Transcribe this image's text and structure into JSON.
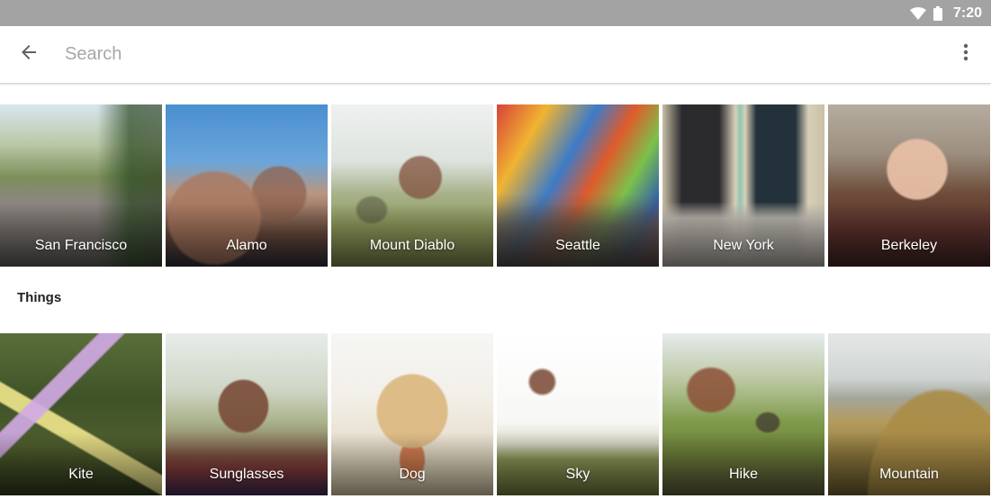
{
  "status_bar": {
    "time": "7:20",
    "icons": [
      "wifi-icon",
      "battery-icon"
    ]
  },
  "toolbar": {
    "back_icon": "arrow-left-icon",
    "search_placeholder": "Search",
    "overflow_icon": "more-vert-icon"
  },
  "places": [
    {
      "label": "San Francisco"
    },
    {
      "label": "Alamo"
    },
    {
      "label": "Mount Diablo"
    },
    {
      "label": "Seattle"
    },
    {
      "label": "New York"
    },
    {
      "label": "Berkeley"
    }
  ],
  "things_section": {
    "title": "Things"
  },
  "things": [
    {
      "label": "Kite"
    },
    {
      "label": "Sunglasses"
    },
    {
      "label": "Dog"
    },
    {
      "label": "Sky"
    },
    {
      "label": "Hike"
    },
    {
      "label": "Mountain"
    }
  ]
}
